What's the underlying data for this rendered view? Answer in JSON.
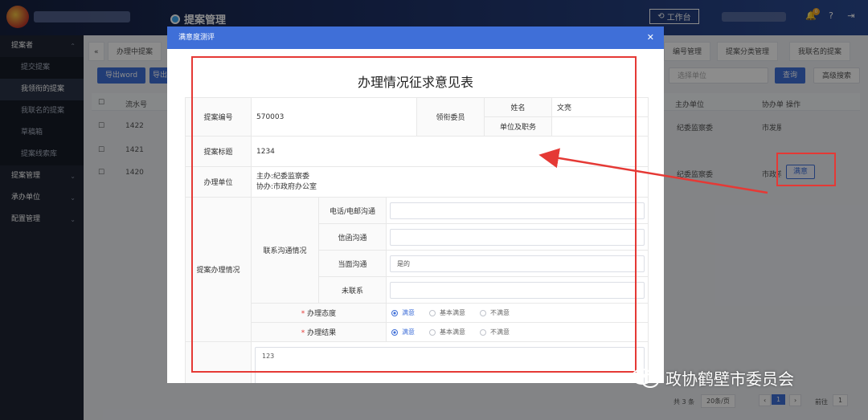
{
  "header": {
    "system_title": "提案管理",
    "workbench_label": "工作台",
    "notification_count": "0"
  },
  "sidebar": {
    "items": [
      {
        "label": "提案者",
        "type": "group"
      },
      {
        "label": "提交提案",
        "type": "sub"
      },
      {
        "label": "我领衔的提案",
        "type": "sub-active"
      },
      {
        "label": "我联名的提案",
        "type": "sub"
      },
      {
        "label": "草稿箱",
        "type": "sub"
      },
      {
        "label": "提案线索库",
        "type": "sub"
      },
      {
        "label": "提案管理",
        "type": "group"
      },
      {
        "label": "承办单位",
        "type": "group"
      },
      {
        "label": "配置管理",
        "type": "group"
      }
    ]
  },
  "background": {
    "tabs": [
      "办理中提案",
      "编号管理",
      "提案分类管理",
      "我联名的提案"
    ],
    "export_word_label": "导出word",
    "export_label_partial": "导出",
    "unit_select_placeholder": "选择单位",
    "query_label": "查询",
    "advanced_search_label": "高级搜索",
    "columns": {
      "serial": "流水号",
      "host_unit": "主办单位",
      "cohost_unit": "协办单位",
      "action": "操作"
    },
    "rows": [
      {
        "serial": "1422",
        "host_unit": "纪委监察委",
        "cohost_unit": "市发展"
      },
      {
        "serial": "1421",
        "host_unit": "",
        "cohost_unit": ""
      },
      {
        "serial": "1420",
        "host_unit": "纪委监察委",
        "cohost_unit": "市政府",
        "action": "满意"
      }
    ],
    "pager": {
      "total": "共 3 条",
      "page_size": "20条/页",
      "current_page": "1",
      "goto_label": "前往",
      "goto_value": "1"
    }
  },
  "modal": {
    "title": "满意度测评",
    "close_icon": "close-icon",
    "form_title": "办理情况征求意见表",
    "proposal_no_label": "提案编号",
    "proposal_no": "570003",
    "lead_member_label": "领衔委员",
    "name_label": "姓名",
    "name_value": "文亮",
    "unit_position_label": "单位及职务",
    "unit_position_value": "",
    "proposal_title_label": "提案标题",
    "proposal_title": "1234",
    "handling_unit_label": "办理单位",
    "host_unit": "主办:纪委监察委",
    "cohost_unit": "协办:市政府办公室",
    "handling_status_label": "提案办理情况",
    "contact_label": "联系沟通情况",
    "contact_methods": [
      {
        "label": "电话/电邮沟通",
        "value": ""
      },
      {
        "label": "信函沟通",
        "value": ""
      },
      {
        "label": "当面沟通",
        "value": "是的"
      },
      {
        "label": "未联系",
        "value": ""
      }
    ],
    "attitude_label": "办理态度",
    "result_label": "办理结果",
    "required_mark": "*",
    "options": [
      "满意",
      "基本满意",
      "不满意"
    ],
    "attitude_selected": "满意",
    "result_selected": "满意",
    "comment_value": "123"
  },
  "watermark": {
    "text": "政协鹤壁市委员会"
  },
  "colors": {
    "primary": "#3f6fd8",
    "annotation_red": "#e53935",
    "sidebar": "#1f2533"
  }
}
